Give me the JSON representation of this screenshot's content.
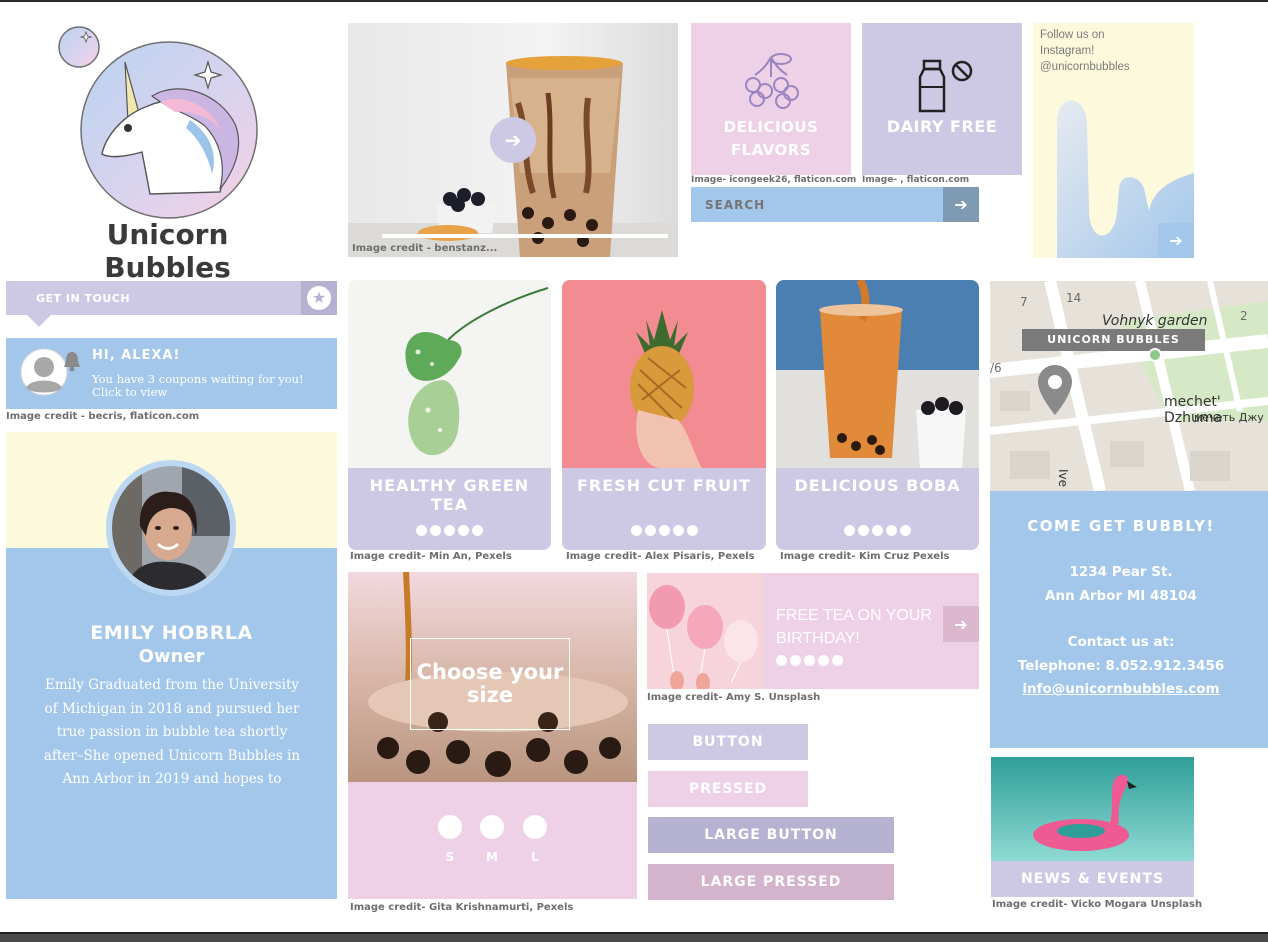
{
  "brand": {
    "name": "Unicorn Bubbles"
  },
  "hero": {
    "credit": "Image credit - benstanz..."
  },
  "tiles": [
    {
      "label_line1": "DELICIOUS",
      "label_line2": "FLAVORS",
      "credit": "Image- icongeek26, flaticon.com"
    },
    {
      "label_line1": "DAIRY FREE",
      "label_line2": "",
      "credit": "Image- , flaticon.com"
    }
  ],
  "search": {
    "placeholder": "SEARCH"
  },
  "instagram": {
    "line1": "Follow us on",
    "line2": "Instagram!",
    "line3": "@unicornbubbles"
  },
  "contact_tab": {
    "label": "GET IN TOUCH"
  },
  "notification": {
    "greeting": "HI, ALEXA!",
    "line1": "You have 3 coupons waiting for you!",
    "line2": "Click to view",
    "credit": "Image credit - becris, flaticon.com"
  },
  "owner": {
    "name": "EMILY HOBRLA",
    "title": "Owner",
    "bio": "Emily Graduated from the University of Michigan in 2018 and pursued her true passion in bubble tea shortly after–She opened Unicorn Bubbles in Ann Arbor in 2019 and hopes to"
  },
  "products": [
    {
      "label": "HEALTHY GREEN TEA",
      "credit": "Image credit- Min An, Pexels"
    },
    {
      "label": "FRESH CUT FRUIT",
      "credit": "Image credit- Alex Pisaris, Pexels"
    },
    {
      "label": "DELICIOUS BOBA",
      "credit": "Image credit- Kim Cruz Pexels"
    }
  ],
  "size_card": {
    "heading": "Choose your size",
    "sizes": [
      "S",
      "M",
      "L"
    ],
    "credit": "Image credit- Gita Krishnamurti, Pexels"
  },
  "promo": {
    "text_line1": "FREE TEA ON YOUR",
    "text_line2": "BIRTHDAY!",
    "credit": "Image credit- Amy S. Unsplash"
  },
  "buttons": {
    "button": "BUTTON",
    "pressed": "PRESSED",
    "large_button": "LARGE BUTTON",
    "large_pressed": "LARGE PRESSED"
  },
  "map": {
    "marker_label": "UNICORN BUBBLES",
    "label_garden": "Vohnyk garden",
    "label_mosque": "mechet' Dzhuma",
    "label_mosque_cyr": "мечеть Джу",
    "num_7": "7",
    "num_14": "14",
    "num_2": "2",
    "num_76": "/6",
    "num_2b": "2",
    "street": "Ive"
  },
  "location": {
    "heading": "COME GET BUBBLY!",
    "street": "1234 Pear St.",
    "city": "Ann Arbor MI 48104",
    "contact_heading": "Contact us at:",
    "phone": "Telephone: 8.052.912.3456",
    "email": "info@unicornbubbles.com"
  },
  "news": {
    "label": "NEWS & EVENTS",
    "credit": "Image credit- Vicko Mogara Unsplash"
  },
  "colors": {
    "lavender": "#cdc9e4",
    "pink": "#eed1e6",
    "blue": "#a3c7eb",
    "cream": "#fdf9dc"
  }
}
